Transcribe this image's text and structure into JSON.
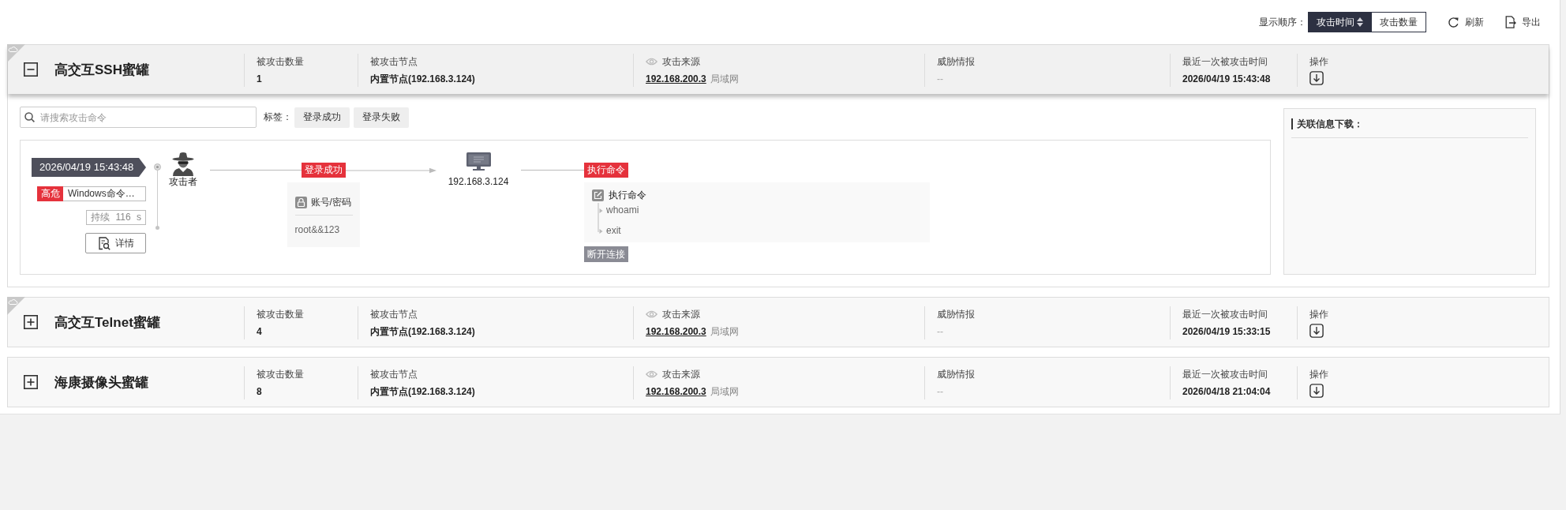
{
  "toolbar": {
    "sort_label": "显示顺序：",
    "sort_options": [
      {
        "label": "攻击时间",
        "selected": true
      },
      {
        "label": "攻击数量",
        "selected": false
      }
    ],
    "actions": [
      {
        "kind": "refresh",
        "label": "刷新"
      },
      {
        "kind": "export",
        "label": "导出"
      }
    ]
  },
  "honeypots": [
    {
      "name": "高交互SSH蜜罐",
      "cloud_flag": true,
      "expanded": true,
      "columns": [
        {
          "kind": "count",
          "label": "被攻击数量",
          "value": "1"
        },
        {
          "kind": "node",
          "label": "被攻击节点",
          "value": "内置节点(192.168.3.124)"
        },
        {
          "kind": "source",
          "label": "攻击来源",
          "value": "192.168.200.3",
          "note": "局域网"
        },
        {
          "kind": "intel",
          "label": "威胁情报",
          "value": "--"
        },
        {
          "kind": "time",
          "label": "最近一次被攻击时间",
          "value": "2026/04/19 15:43:48"
        },
        {
          "kind": "action",
          "label": "操作"
        }
      ],
      "detail": {
        "search": {
          "placeholder": "请搜索攻击命令"
        },
        "tags_label": "标签：",
        "tags": [
          "登录成功",
          "登录失败"
        ],
        "timeline": {
          "time": "2026/04/19 15:43:48",
          "severity": "高危",
          "alert": "Windows命令…",
          "duration": "持续 116 s",
          "details_button": "详情",
          "attacker": "攻击者",
          "login_tag": "登录成功",
          "credential": {
            "title": "账号/密码",
            "value": "root&&123"
          },
          "target": "192.168.3.124",
          "command_tag": "执行命令",
          "commands": {
            "title": "执行命令",
            "items": [
              "whoami",
              "exit"
            ]
          },
          "end_tag": "断开连接"
        },
        "side_panel": {
          "title": "关联信息下载："
        }
      }
    },
    {
      "name": "高交互Telnet蜜罐",
      "cloud_flag": true,
      "expanded": false,
      "columns": [
        {
          "kind": "count",
          "label": "被攻击数量",
          "value": "4"
        },
        {
          "kind": "node",
          "label": "被攻击节点",
          "value": "内置节点(192.168.3.124)"
        },
        {
          "kind": "source",
          "label": "攻击来源",
          "value": "192.168.200.3",
          "note": "局域网"
        },
        {
          "kind": "intel",
          "label": "威胁情报",
          "value": "--"
        },
        {
          "kind": "time",
          "label": "最近一次被攻击时间",
          "value": "2026/04/19 15:33:15"
        },
        {
          "kind": "action",
          "label": "操作"
        }
      ]
    },
    {
      "name": "海康摄像头蜜罐",
      "cloud_flag": false,
      "expanded": false,
      "columns": [
        {
          "kind": "count",
          "label": "被攻击数量",
          "value": "8"
        },
        {
          "kind": "node",
          "label": "被攻击节点",
          "value": "内置节点(192.168.3.124)"
        },
        {
          "kind": "source",
          "label": "攻击来源",
          "value": "192.168.200.3",
          "note": "局域网"
        },
        {
          "kind": "intel",
          "label": "威胁情报",
          "value": "--"
        },
        {
          "kind": "time",
          "label": "最近一次被攻击时间",
          "value": "2026/04/18 21:04:04"
        },
        {
          "kind": "action",
          "label": "操作"
        }
      ]
    }
  ]
}
